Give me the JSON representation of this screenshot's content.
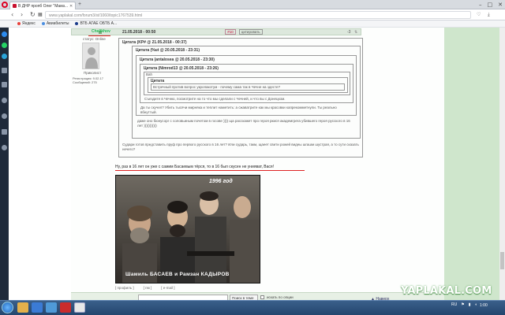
{
  "browser": {
    "tab_title": "В ДНР пропб Олег \"Мамз...",
    "url": "www.yaplakal.com/forum3/st/1060/topic1767539.html",
    "bookmarks": [
      "Яндекс",
      "Авиабилеты",
      "ВТБ АГАЕ ОБТБ А..."
    ]
  },
  "post": {
    "header_date": "21.05.2018 - 00:50",
    "badge": "#10",
    "quote_btn": "цитировать",
    "score": "-3",
    "username": "Chelikhov",
    "status": "статус: Online",
    "rank": "Приколист",
    "reg": "Регистрация: 9.02.17",
    "msgs": "Сообщений: 275",
    "q1_head": "Цитата (KP# @ 21.05.2018 - 00:37)",
    "q2_head": "Цитата (%ut @ 20.05.2018 - 23:31)",
    "q3_head": "Цитата (antalosea @ 20.05.2018 - 23:30)",
    "q4_head": "Цитата (Nimrod13 @ 20.05.2018 - 23:26)",
    "q5_label": "Bah",
    "q5_head": "Цитата",
    "q5_text": "Встречный против вопрос укропакотум - почему сама так в Чечне на здесте?",
    "q4_text": "Съездите в Чечню, посмотрите на то что мы сделали с Чечней, и что вы с Донецком.",
    "q3_text": "Да ты скучел? Убить тысячи мирняка и теплит наметить: а сжаватрите как мы красовки капрекомметнули. Ты реально вбнуттый.",
    "q2_text": "даже оно бюнусорг с соловьиным почетом в госове )))) ща расскажет про героя ркися академгрега убившего героя русского в 16 лет )))))))))))",
    "q1_text": "Судари готов представить пруф про первого русского в 16 лет? Или сударь, такм, щаеет свити рожей видеы шгашм шустрая, а то сути сказать нечего?",
    "reply": "Ну, раз в 16 лет он уже с самим Басаевым тёрся, то в 16 был скусен не унияват, Вася!",
    "photo_year": "1996 год",
    "photo_caption": "Шамиль БАСАЕВ и Рамзан КАДЫРОВ",
    "links": [
      "[ профиль ]",
      "[ пм ]",
      "[ e-mail ]"
    ]
  },
  "footer": {
    "search_scope": "Поиск в теме ▾",
    "checkbox_label": "искать по опции",
    "nav_up": "▲ Наверх"
  },
  "logo": "YAPLAKAL.COM",
  "clock": {
    "time": "1:00",
    "lang": "RU"
  }
}
